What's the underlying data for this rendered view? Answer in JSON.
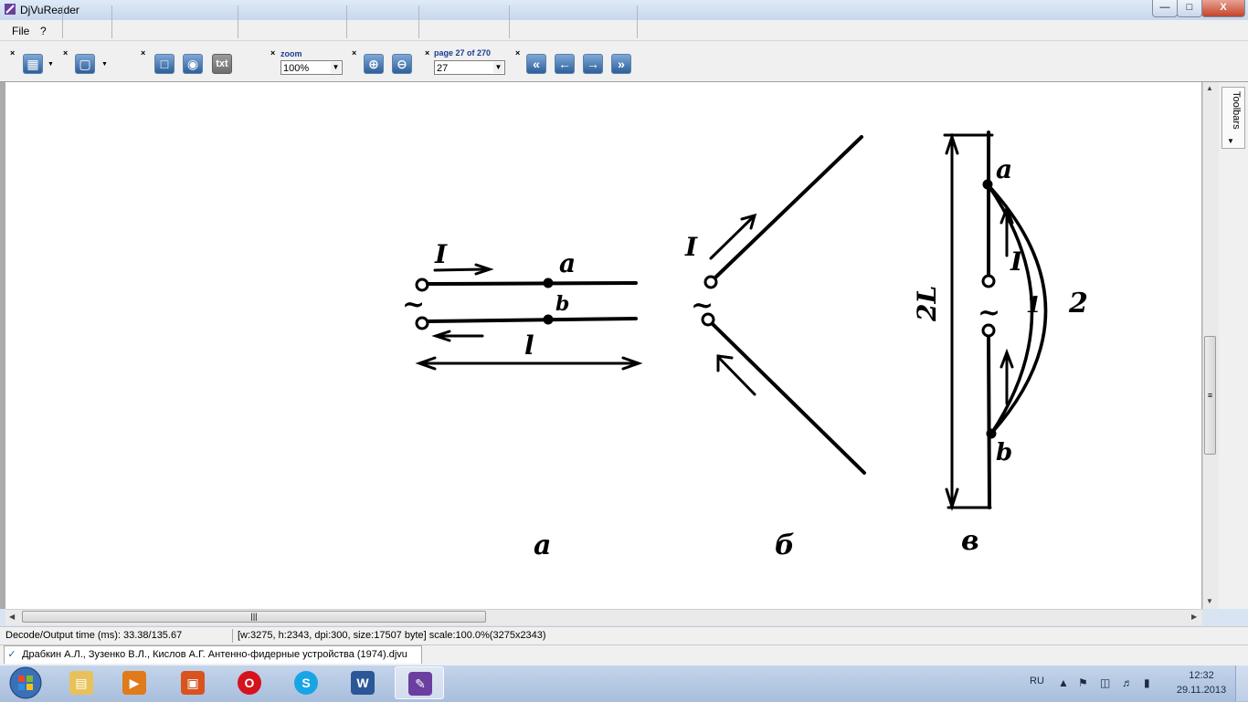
{
  "window": {
    "title": "DjVuReader"
  },
  "window_controls": {
    "minimize": "—",
    "maximize": "□",
    "close": "X"
  },
  "menu": {
    "items": [
      "File",
      "?"
    ]
  },
  "toolbar": {
    "close_glyph": "×",
    "zoom_label": "zoom",
    "zoom_value": "100%",
    "page_label": "page 27 of 270",
    "page_value": "27",
    "text_button": "txt"
  },
  "diagram": {
    "labels": {
      "a_current": "I",
      "a_point_a": "a",
      "a_point_b": "b",
      "a_length": "l",
      "a_tilde": "~",
      "a_caption": "а",
      "b_current": "I",
      "b_tilde": "~",
      "b_caption": "б",
      "c_point_a": "a",
      "c_point_b": "b",
      "c_current": "I",
      "c_length": "2L",
      "c_curve1": "1",
      "c_curve2": "2",
      "c_tilde": "~",
      "c_caption": "в"
    }
  },
  "side_panel": {
    "toolbars_label": "Toolbars"
  },
  "statusbar": {
    "decode_time": "Decode/Output time (ms): 33.38/135.67",
    "image_info": "[w:3275, h:2343, dpi:300, size:17507 byte] scale:100.0%(3275x2343)"
  },
  "document_tab": {
    "title": "Драбкин А.Л., Зузенко В.Л., Кислов А.Г. Антенно-фидерные устройства (1974).djvu"
  },
  "taskbar": {
    "apps": [
      "explorer",
      "media-player",
      "package-manager",
      "opera",
      "skype",
      "word",
      "djvu-reader"
    ],
    "language": "RU",
    "time": "12:32",
    "date": "29.11.2013"
  },
  "colors": {
    "accent": "#2e5f9b",
    "taskbar": "#b4c8e2",
    "close": "#c4432a"
  }
}
